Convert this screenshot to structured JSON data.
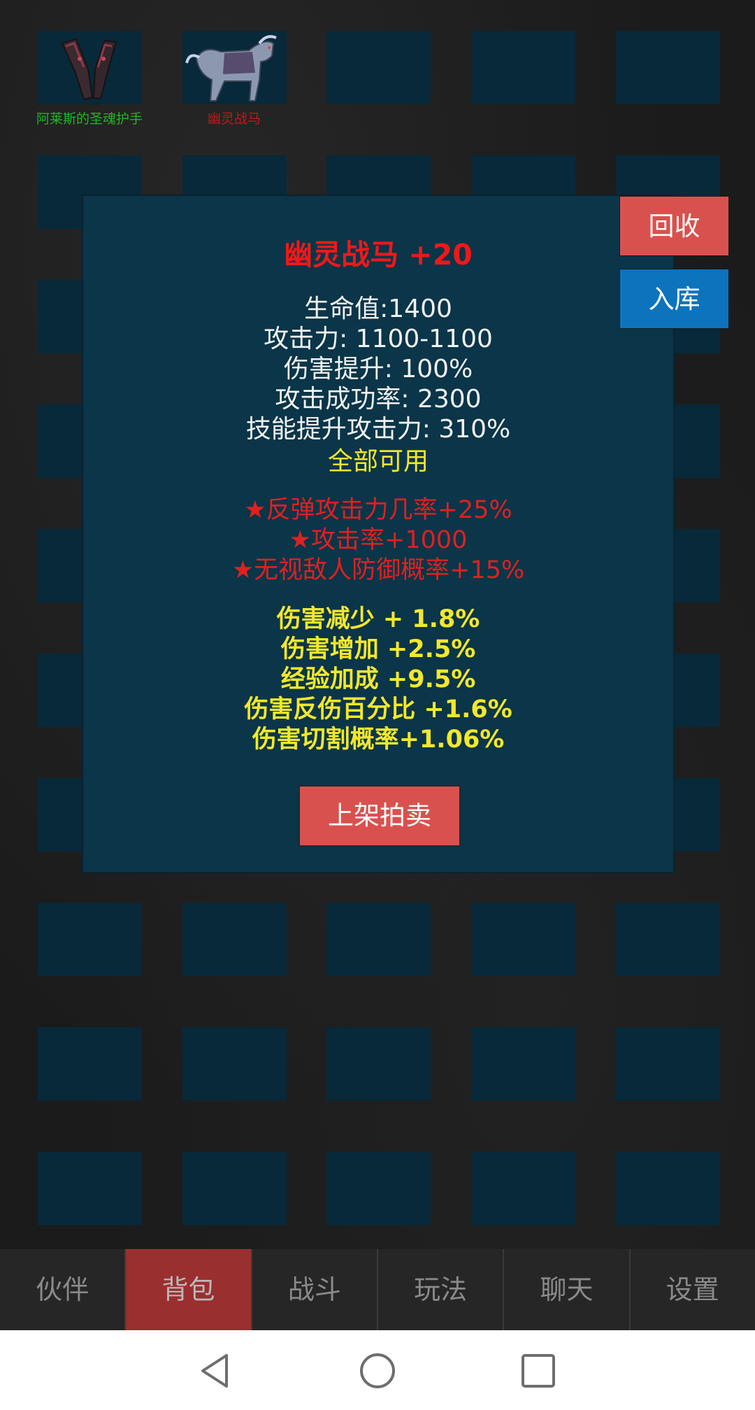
{
  "inventory": {
    "items": [
      {
        "name": "阿莱斯的圣魂护手",
        "color": "#22b522",
        "icon": "gauntlet-icon"
      },
      {
        "name": "幽灵战马",
        "color": "#c01818",
        "icon": "ghost-warhorse-icon"
      }
    ]
  },
  "popup": {
    "title": "幽灵战马 +20",
    "stats": [
      "生命值:1400",
      "攻击力: 1100-1100",
      "伤害提升: 100%",
      "攻击成功率: 2300",
      "技能提升攻击力: 310%"
    ],
    "usable": "全部可用",
    "red_stats": [
      "★反弹攻击力几率+25%",
      "★攻击率+1000",
      "★无视敌人防御概率+15%"
    ],
    "yellow_stats": [
      "伤害减少 + 1.8%",
      "伤害增加 +2.5%",
      "经验加成 +9.5%",
      "伤害反伤百分比 +1.6%",
      "伤害切割概率+1.06%"
    ],
    "auction_label": "上架拍卖"
  },
  "side_buttons": {
    "recycle": "回收",
    "store": "入库"
  },
  "tabs": [
    "伙伴",
    "背包",
    "战斗",
    "玩法",
    "聊天",
    "设置"
  ],
  "active_tab": "背包",
  "colors": {
    "slot": "#07293a",
    "popup_bg": "#0b3548",
    "title_red": "#f01818",
    "stat_yellow": "#f3e82a",
    "button_red": "#d9514e",
    "button_blue": "#0d73bd",
    "tab_active": "#9a2f2f"
  }
}
